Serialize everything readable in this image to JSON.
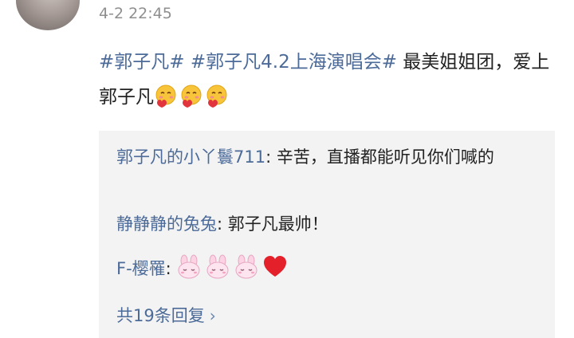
{
  "post": {
    "timestamp": "4-2 22:45",
    "hashtag1": "#郭子凡#",
    "hashtag2": "#郭子凡4.2上海演唱会#",
    "text_part1": " 最美姐姐团，爱上郭子凡",
    "emojis": [
      "hug-emoji",
      "hug-emoji",
      "hug-emoji"
    ]
  },
  "comments": [
    {
      "user": "郭子凡的小丫鬟711",
      "text": ": 辛苦，直播都能听见你们喊的"
    },
    {
      "user": "静静静的兔兔",
      "text": ": 郭子凡最帅！"
    },
    {
      "user": "F-樱罹",
      "text": ": ",
      "emojis": [
        "bunny-emoji",
        "bunny-emoji",
        "bunny-emoji",
        "heart-emoji"
      ]
    }
  ],
  "replies": {
    "label": "共19条回复",
    "chevron": "›"
  },
  "colors": {
    "link": "#4c6b99",
    "timestamp": "#8f8f8f",
    "box_bg": "#f3f3f3"
  }
}
